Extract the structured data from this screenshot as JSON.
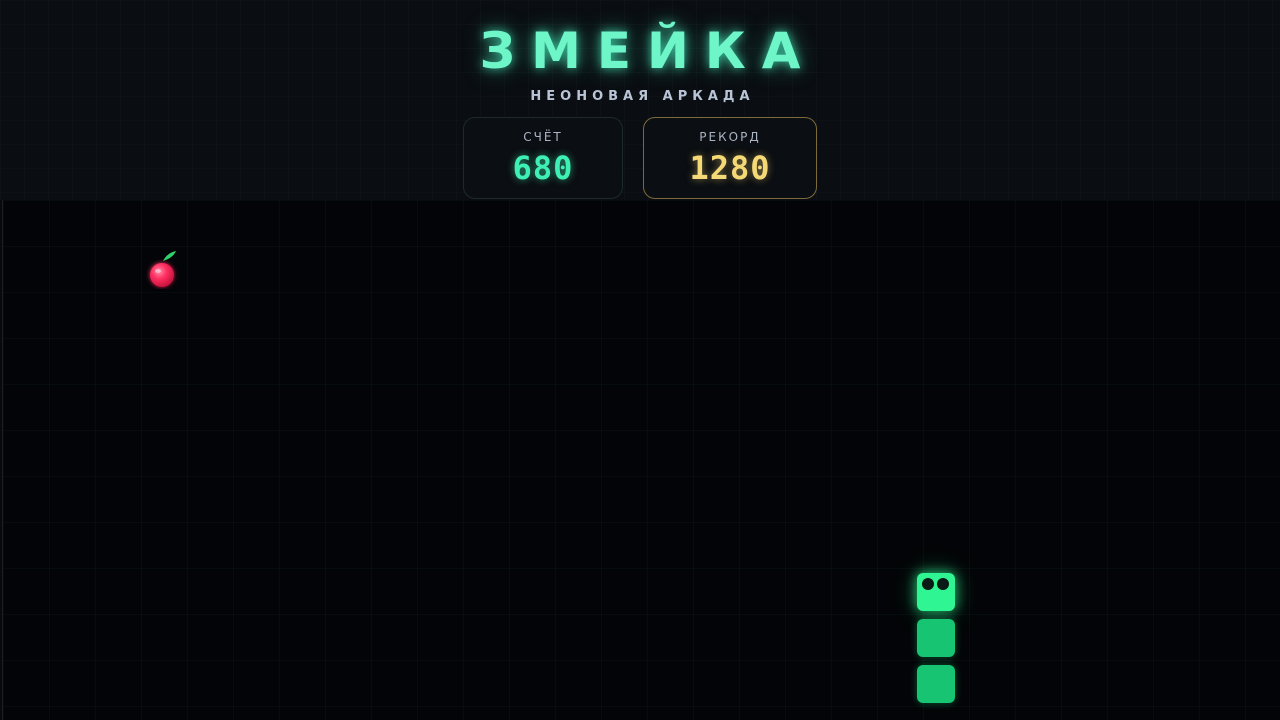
{
  "header": {
    "title": "ЗМЕЙКА",
    "subtitle": "НЕОНОВАЯ АРКАДА"
  },
  "score": {
    "label": "СЧЁТ",
    "value": "680"
  },
  "record": {
    "label": "РЕКОРД",
    "value": "1280"
  },
  "board": {
    "food": "apple-icon",
    "snake_length": 3,
    "direction": "up"
  },
  "colors": {
    "accent": "#3ef0b4",
    "record": "#f5d976",
    "snake_head": "#2ff592",
    "snake_body": "#17c472",
    "apple": "#ff2a5a"
  }
}
